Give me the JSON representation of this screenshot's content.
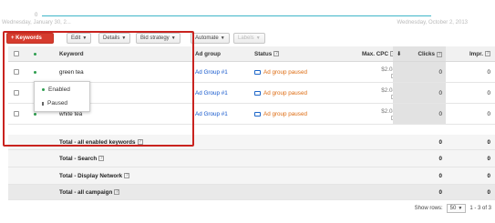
{
  "timeline": {
    "axis_zero": "0",
    "start_date": "Wednesday, January 30, 2...",
    "end_date": "Wednesday, October 2, 2013"
  },
  "toolbar": {
    "add_keywords": "+ Keywords",
    "edit": "Edit",
    "details": "Details",
    "bid_strategy": "Bid strategy",
    "automate": "Automate",
    "labels": "Labels"
  },
  "table": {
    "headers": {
      "keyword": "Keyword",
      "ad_group": "Ad group",
      "status": "Status",
      "max_cpc": "Max. CPC",
      "clicks": "Clicks",
      "impr": "Impr."
    },
    "rows": [
      {
        "keyword": "green tea",
        "ad_group": "Ad Group #1",
        "status": "Ad group paused",
        "max_cpc": "$2.08",
        "clicks": "0",
        "impr": "0"
      },
      {
        "keyword": "",
        "ad_group": "Ad Group #1",
        "status": "Ad group paused",
        "max_cpc": "$2.08",
        "clicks": "0",
        "impr": "0"
      },
      {
        "keyword": "white tea",
        "ad_group": "Ad Group #1",
        "status": "Ad group paused",
        "max_cpc": "$2.08",
        "clicks": "0",
        "impr": "0"
      }
    ],
    "totals": [
      {
        "label": "Total - all enabled keywords",
        "clicks": "0",
        "impr": "0"
      },
      {
        "label": "Total - Search",
        "clicks": "0",
        "impr": "0"
      },
      {
        "label": "Total - Display Network",
        "clicks": "0",
        "impr": "0"
      },
      {
        "label": "Total - all campaign",
        "clicks": "0",
        "impr": "0"
      }
    ]
  },
  "status_popup": {
    "enabled": "Enabled",
    "paused": "Paused"
  },
  "footer": {
    "show_rows_label": "Show rows:",
    "rows_value": "50",
    "range": "1 - 3 of 3"
  },
  "colors": {
    "accent_red": "#c9231f",
    "link_blue": "#1155cc",
    "status_orange": "#dd6a0f",
    "enabled_green": "#2e9e4f"
  }
}
